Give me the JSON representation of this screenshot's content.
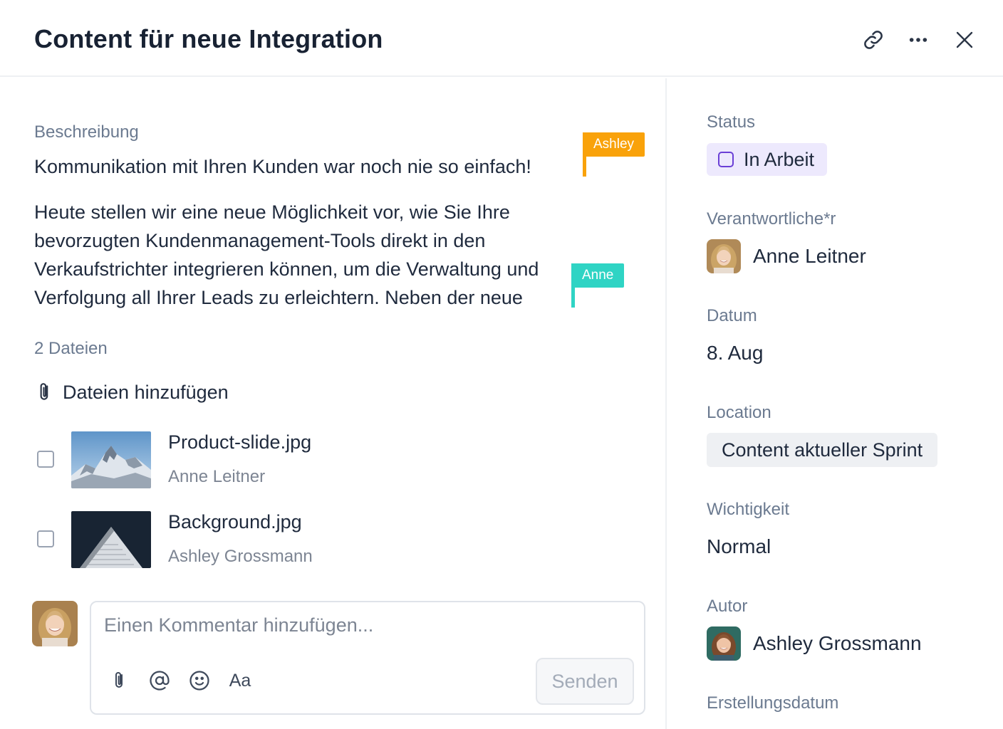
{
  "header": {
    "title": "Content für neue Integration",
    "icons": [
      "link-icon",
      "more-icon",
      "close-icon"
    ]
  },
  "description": {
    "label": "Beschreibung",
    "line1": "Kommunikation mit Ihren Kunden war noch nie so einfach!",
    "para_lines": [
      "Heute stellen wir eine neue Möglichkeit vor, wie Sie Ihre",
      "bevorzugten Kundenmanagement-Tools direkt in den",
      "Verkaufstrichter integrieren können, um die Verwaltung und",
      "Verfolgung all Ihrer Leads zu erleichtern. Neben der neue"
    ],
    "cursors": [
      {
        "name": "Ashley",
        "color": "#f9a20a"
      },
      {
        "name": "Anne",
        "color": "#2fd4c4"
      }
    ]
  },
  "files": {
    "count_label": "2 Dateien",
    "add_label": "Dateien hinzufügen",
    "items": [
      {
        "name": "Product-slide.jpg",
        "author": "Anne Leitner"
      },
      {
        "name": "Background.jpg",
        "author": "Ashley Grossmann"
      }
    ]
  },
  "comment": {
    "placeholder": "Einen Kommentar hinzufügen...",
    "format_label": "Aa",
    "send_label": "Senden"
  },
  "sidebar": {
    "status_label": "Status",
    "status_value": "In Arbeit",
    "status_color": "#6a3fd6",
    "assignee_label": "Verantwortliche*r",
    "assignee_name": "Anne Leitner",
    "date_label": "Datum",
    "date_value": "8. Aug",
    "location_label": "Location",
    "location_value": "Content aktueller Sprint",
    "priority_label": "Wichtigkeit",
    "priority_value": "Normal",
    "author_label": "Autor",
    "author_name": "Ashley Grossmann",
    "created_label": "Erstellungsdatum"
  }
}
